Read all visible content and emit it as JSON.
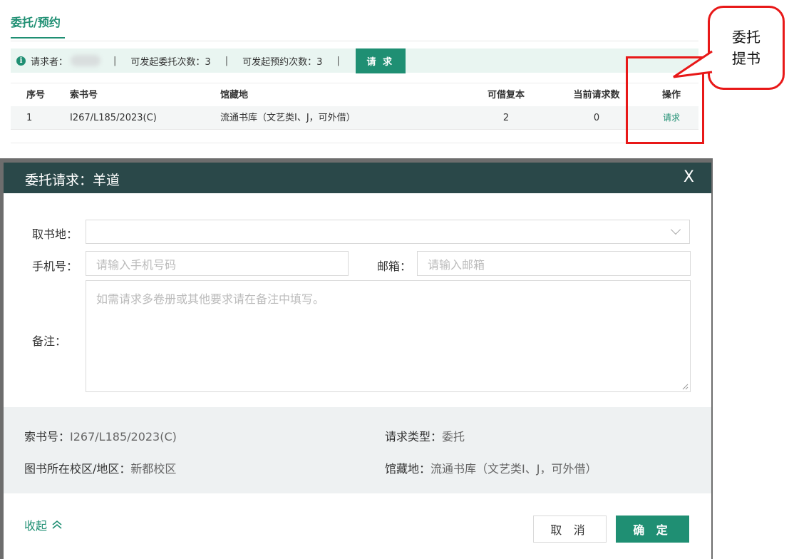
{
  "tab": {
    "title": "委托/预约"
  },
  "info_bar": {
    "requester_label": "请求者：",
    "separator": "|",
    "delegate_count_text": "可发起委托次数：3",
    "reserve_count_text": "可发起预约次数：3",
    "request_button": "请 求"
  },
  "table": {
    "headers": [
      "序号",
      "索书号",
      "馆藏地",
      "可借复本",
      "当前请求数",
      "操作"
    ],
    "rows": [
      [
        "1",
        "I267/L185/2023(C)",
        "流通书库（文艺类I、J，可外借）",
        "2",
        "0",
        "请求"
      ]
    ]
  },
  "callout": {
    "line1": "委托",
    "line2": "提书"
  },
  "dialog": {
    "title": "委托请求：羊道",
    "close": "X",
    "pickup_label": "取书地：",
    "phone_label": "手机号：",
    "phone_placeholder": "请输入手机号码",
    "email_label": "邮箱：",
    "email_placeholder": "请输入邮箱",
    "note_label": "备注：",
    "note_placeholder": "如需请求多卷册或其他要求请在备注中填写。",
    "info": {
      "call_no_label": "索书号：",
      "call_no_value": "I267/L185/2023(C)",
      "request_type_label": "请求类型：",
      "request_type_value": "委托",
      "campus_label": "图书所在校区/地区：",
      "campus_value": "新都校区",
      "location_label": "馆藏地：",
      "location_value": "流通书库（文艺类I、J，可外借）"
    },
    "collapse_label": "收起",
    "cancel_button": "取 消",
    "confirm_button": "确 定"
  },
  "colors": {
    "accent": "#1f8f73",
    "header_bg": "#2a4849",
    "callout_red": "#e81818"
  }
}
